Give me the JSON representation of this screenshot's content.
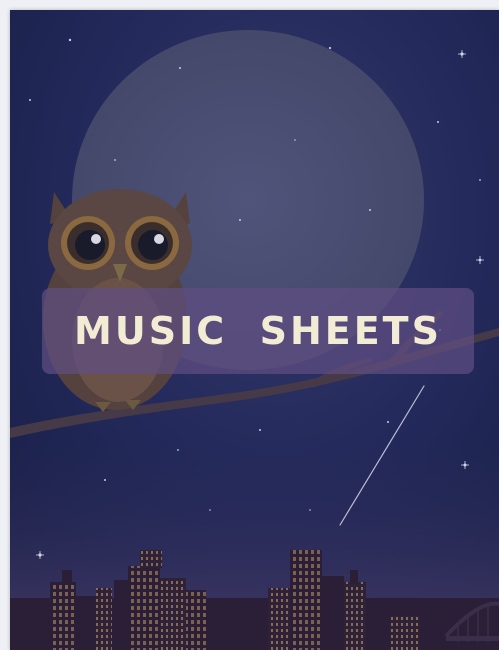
{
  "cover": {
    "title": "MUSIC  SHEETS"
  },
  "colors": {
    "sky_top": "#1d2450",
    "sky_bottom": "#2b2d5c",
    "moon": "#4a4e6e",
    "owl_body": "#5a4642",
    "owl_eye_ring": "#8a6840",
    "branch": "#463a48",
    "banner": "#604e82",
    "title_text": "#f3ecd4",
    "city": "#2a1f36",
    "window_light": "#8a6a55"
  },
  "icons": {
    "owl": "owl-illustration",
    "moon": "moon-illustration",
    "skyline": "city-skyline",
    "shooting_star": "shooting-star"
  }
}
